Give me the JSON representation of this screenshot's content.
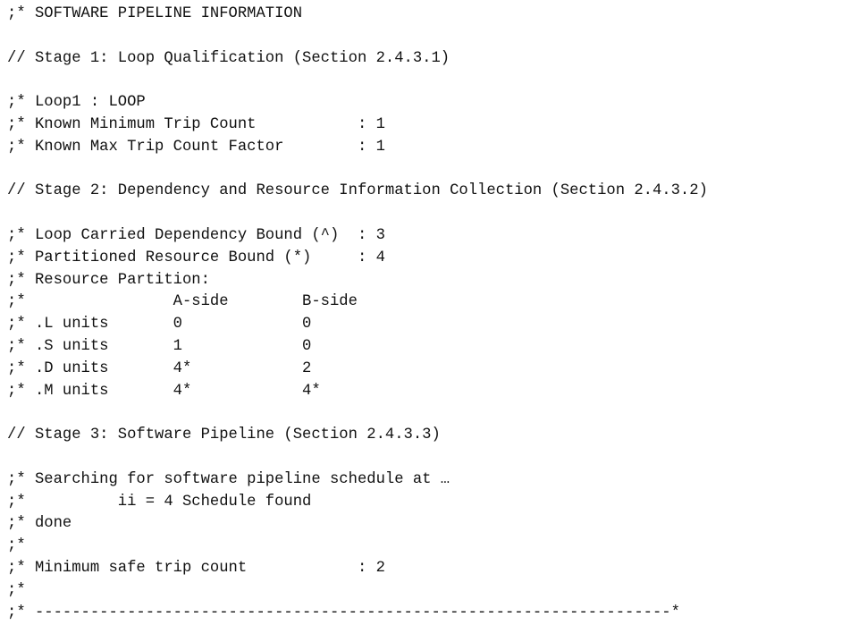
{
  "document": {
    "kind": "assembly-listing-comment-block",
    "title": "SOFTWARE PIPELINE INFORMATION",
    "comment_prefix": ";*",
    "directive_prefix": "//",
    "colors": {
      "background": "#ffffff",
      "text": "#111111"
    },
    "lines": [
      ";* SOFTWARE PIPELINE INFORMATION",
      "",
      "// Stage 1: Loop Qualification (Section 2.4.3.1)",
      "",
      ";* Loop1 : LOOP",
      ";* Known Minimum Trip Count           : 1",
      ";* Known Max Trip Count Factor        : 1",
      "",
      "// Stage 2: Dependency and Resource Information Collection (Section 2.4.3.2)",
      "",
      ";* Loop Carried Dependency Bound (^)  : 3",
      ";* Partitioned Resource Bound (*)     : 4",
      ";* Resource Partition:",
      ";*                A-side        B-side",
      ";* .L units       0             0",
      ";* .S units       1             0",
      ";* .D units       4*            2",
      ";* .M units       4*            4*",
      "",
      "// Stage 3: Software Pipeline (Section 2.4.3.3)",
      "",
      ";* Searching for software pipeline schedule at …",
      ";*          ii = 4 Schedule found",
      ";* done",
      ";*",
      ";* Minimum safe trip count            : 2",
      ";*",
      ";* ---------------------------------------------------------------------*"
    ],
    "sections": {
      "header": ";* SOFTWARE PIPELINE INFORMATION",
      "stage1": {
        "heading": "// Stage 1: Loop Qualification (Section 2.4.3.1)",
        "stage_number": "1",
        "stage_name": "Loop Qualification",
        "section_ref": "2.4.3.1",
        "loop_label": "Loop1 : LOOP",
        "entries": [
          {
            "label": "Known Minimum Trip Count",
            "value": "1"
          },
          {
            "label": "Known Max Trip Count Factor",
            "value": "1"
          }
        ]
      },
      "stage2": {
        "heading": "// Stage 2: Dependency and Resource Information Collection (Section 2.4.3.2)",
        "stage_number": "2",
        "stage_name": "Dependency and Resource Information Collection",
        "section_ref": "2.4.3.2",
        "entries": [
          {
            "label": "Loop Carried Dependency Bound (^)",
            "value": "3"
          },
          {
            "label": "Partitioned Resource Bound (*)",
            "value": "4"
          }
        ],
        "resource_partition_label": "Resource Partition:",
        "resource_partition_table": {
          "columns": [
            "",
            "A-side",
            "B-side"
          ],
          "rows": [
            [
              ".L units",
              "0",
              "0"
            ],
            [
              ".S units",
              "1",
              "0"
            ],
            [
              ".D units",
              "4*",
              "2"
            ],
            [
              ".M units",
              "4*",
              "4*"
            ]
          ]
        }
      },
      "stage3": {
        "heading": "// Stage 3: Software Pipeline (Section 2.4.3.3)",
        "stage_number": "3",
        "stage_name": "Software Pipeline",
        "section_ref": "2.4.3.3",
        "search_message": "Searching for software pipeline schedule at …",
        "schedule_result": "ii = 4 Schedule found",
        "ii_value": "4",
        "done_message": "done",
        "entries": [
          {
            "label": "Minimum safe trip count",
            "value": "2"
          }
        ]
      },
      "footer_rule": "---------------------------------------------------------------------*"
    }
  }
}
